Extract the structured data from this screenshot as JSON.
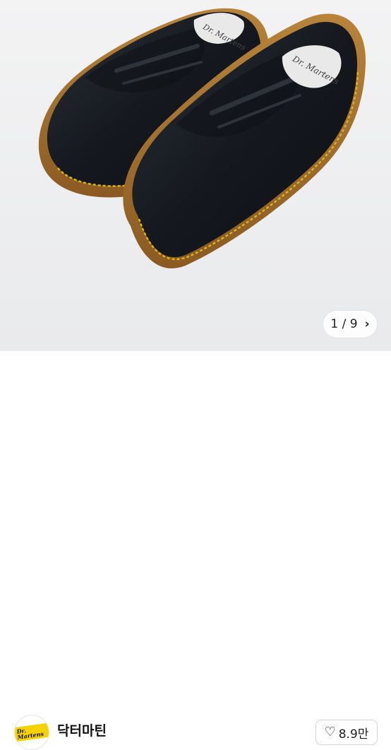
{
  "product_image": {
    "alt": "black leather penny loafers",
    "insole_logo_text": "Dr. Martens"
  },
  "pager": {
    "text": "1 / 9",
    "next_icon": "chevron-right-icon"
  },
  "shop": {
    "name": "닥터마틴",
    "avatar_logo_text": "Dr. Martens"
  },
  "like": {
    "icon": "heart-outline-icon",
    "count": "8.9만"
  },
  "colors": {
    "shoe": "#15191f",
    "stitch": "#d9b21e",
    "sole": "#a4722f",
    "background": "#eeeff1"
  }
}
